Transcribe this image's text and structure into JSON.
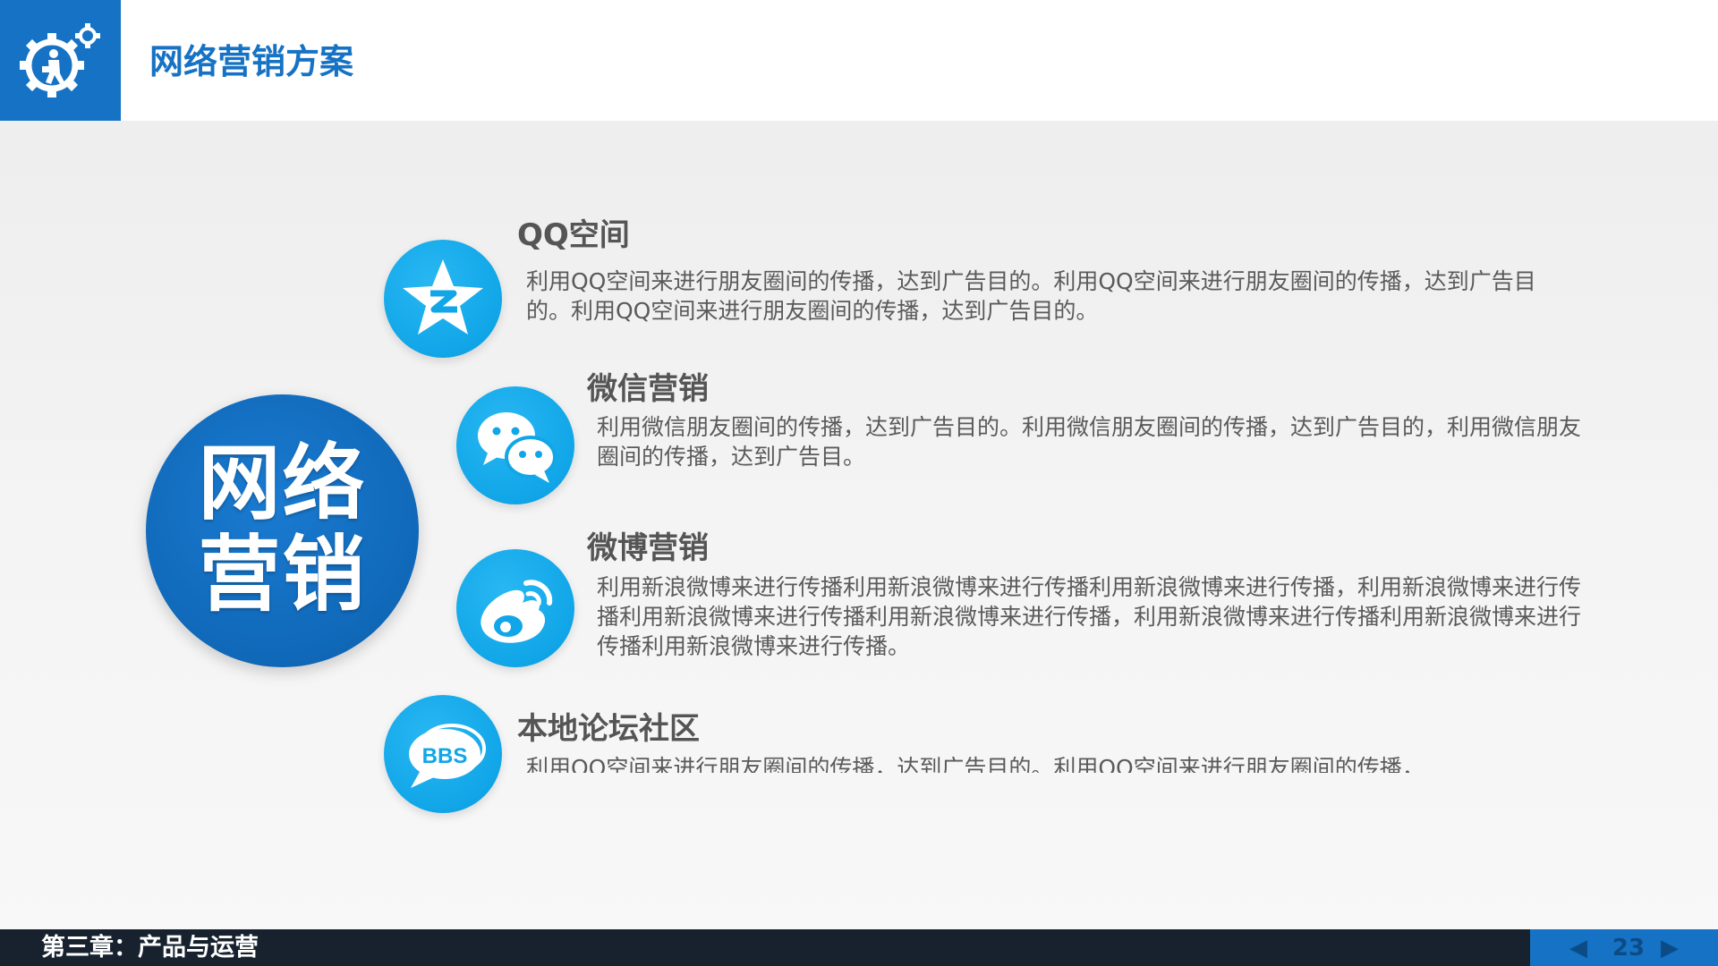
{
  "header": {
    "title": "网络营销方案",
    "logo_icon": "gear-person-icon"
  },
  "center": {
    "line1": "网络",
    "line2": "营销"
  },
  "items": [
    {
      "icon": "qzone-star-icon",
      "title": "QQ空间",
      "desc": "利用QQ空间来进行朋友圈间的传播，达到广告目的。利用QQ空间来进行朋友圈间的传播，达到广告目的。利用QQ空间来进行朋友圈间的传播，达到广告目的。"
    },
    {
      "icon": "wechat-icon",
      "title": "微信营销",
      "desc": "利用微信朋友圈间的传播，达到广告目的。利用微信朋友圈间的传播，达到广告目的，利用微信朋友圈间的传播，达到广告目。"
    },
    {
      "icon": "weibo-icon",
      "title": "微博营销",
      "desc": "利用新浪微博来进行传播利用新浪微博来进行传播利用新浪微博来进行传播，利用新浪微博来进行传播利用新浪微博来进行传播利用新浪微博来进行传播，利用新浪微博来进行传播利用新浪微博来进行传播利用新浪微博来进行传播。"
    },
    {
      "icon": "bbs-icon",
      "title": "本地论坛社区",
      "desc": "利用QQ空间来进行朋友圈间的传播，达到广告目的。利用QQ空间来进行朋友圈间的传播，",
      "bbs_label": "BBS"
    }
  ],
  "footer": {
    "chapter": "第三章：产品与运营",
    "page_number": "23",
    "prev_icon": "triangle-left-icon",
    "next_icon": "triangle-right-icon"
  },
  "colors": {
    "brand_blue": "#1672c4",
    "icon_blue": "#11a6e8",
    "footer_dark": "#17222e"
  }
}
